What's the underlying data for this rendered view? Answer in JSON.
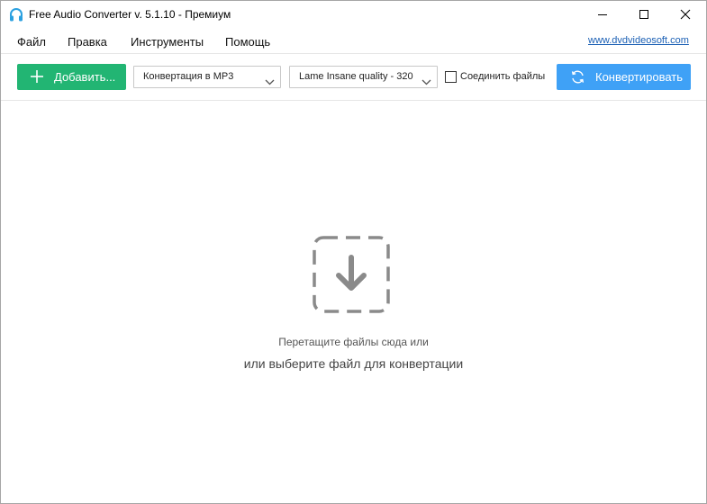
{
  "window": {
    "title": "Free Audio Converter v. 5.1.10 - Премиум",
    "app_icon": "headphones-icon"
  },
  "menu": {
    "items": [
      {
        "label": "Файл"
      },
      {
        "label": "Правка"
      },
      {
        "label": "Инструменты"
      },
      {
        "label": "Помощь"
      }
    ],
    "site_link": "www.dvdvideosoft.com"
  },
  "toolbar": {
    "add_label": "Добавить...",
    "format_selected": "Конвертация в MP3",
    "quality_selected": "Lame Insane quality - 320",
    "join_label": "Соединить файлы",
    "join_checked": false,
    "convert_label": "Конвертировать"
  },
  "dropzone": {
    "line1": "Перетащите файлы сюда или",
    "line2": "или выберите файл для конвертации",
    "icon": "download-arrow-icon"
  },
  "colors": {
    "add_button": "#22b573",
    "convert_button": "#3fa1f6",
    "app_icon": "#2aa0e0",
    "drop_icon": "#8a8a8a"
  }
}
